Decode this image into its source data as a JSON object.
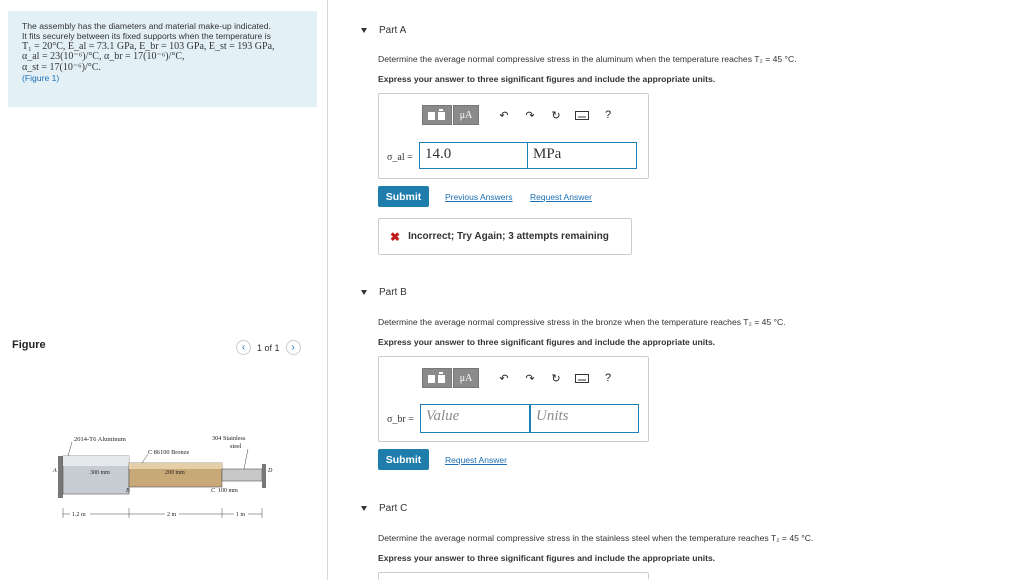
{
  "problem": {
    "line1": "The assembly has the diameters and material make-up indicated.",
    "line2": "It fits securely between its fixed supports when the temperature is",
    "line3": "T₁ = 20°C, E_al = 73.1 GPa, E_br = 103 GPa, E_st = 193 GPa,",
    "line4": "α_al = 23(10⁻⁶)/°C, α_br = 17(10⁻⁶)/°C,",
    "line5": "α_st = 17(10⁻⁶)/°C.",
    "figure_link": "(Figure 1)"
  },
  "figure_panel": {
    "header": "Figure",
    "pager_text": "1 of 1",
    "labels": {
      "aluminum": "2014-T6 Aluminum",
      "bronze": "C 86100 Bronze",
      "steel_1": "304 Stainless",
      "steel_2": "steel",
      "d1": "300 mm",
      "d2": "200 mm",
      "d3": "100 mm",
      "A": "A",
      "B": "B",
      "C": "C",
      "D": "D",
      "L1": "1.2 m",
      "L2": "2 m",
      "L3": "1 m"
    }
  },
  "partA": {
    "title": "Part A",
    "question": "Determine the average normal compressive stress in the aluminum when the temperature reaches T₂ = 45 °C.",
    "instruction": "Express your answer to three significant figures and include the appropriate units.",
    "symbol": "σ_al =",
    "value": "14.0",
    "units": "MPa",
    "submit": "Submit",
    "previous_answers": "Previous Answers",
    "request_answer": "Request Answer",
    "feedback": "Incorrect; Try Again; 3 attempts remaining"
  },
  "partB": {
    "title": "Part B",
    "question": "Determine the average normal compressive stress in the bronze when the temperature reaches T₂ = 45 °C.",
    "instruction": "Express your answer to three significant figures and include the appropriate units.",
    "symbol": "σ_br =",
    "value_placeholder": "Value",
    "units_placeholder": "Units",
    "submit": "Submit",
    "request_answer": "Request Answer"
  },
  "partC": {
    "title": "Part C",
    "question": "Determine the average normal compressive stress in the stainless steel when the temperature reaches T₂ = 45 °C.",
    "instruction": "Express your answer to three significant figures and include the appropriate units."
  },
  "toolbar": {
    "templates_label": "▯▯",
    "mu_label": "μA",
    "help_label": "?"
  }
}
